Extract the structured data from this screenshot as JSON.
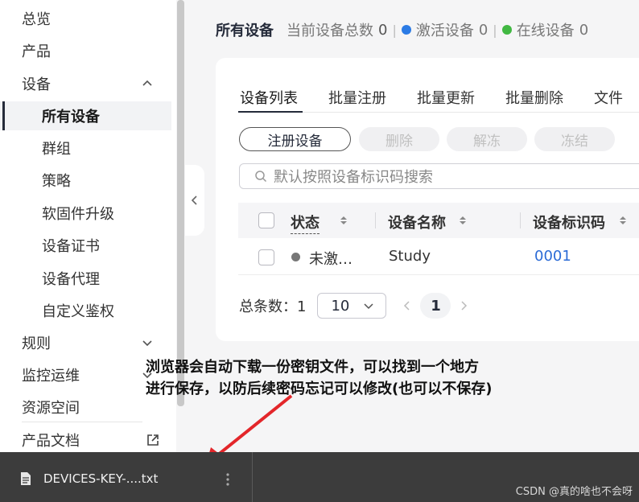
{
  "sidebar": {
    "items": [
      {
        "label": "总览"
      },
      {
        "label": "产品"
      },
      {
        "label": "设备"
      },
      {
        "label": "所有设备"
      },
      {
        "label": "群组"
      },
      {
        "label": "策略"
      },
      {
        "label": "软固件升级"
      },
      {
        "label": "设备证书"
      },
      {
        "label": "设备代理"
      },
      {
        "label": "自定义鉴权"
      },
      {
        "label": "规则"
      },
      {
        "label": "监控运维"
      },
      {
        "label": "资源空间"
      },
      {
        "label": "产品文档"
      }
    ]
  },
  "header": {
    "title": "所有设备",
    "total_label": "当前设备总数",
    "total_value": "0",
    "active_label": "激活设备",
    "active_value": "0",
    "online_label": "在线设备",
    "online_value": "0",
    "active_color": "#2b7be5",
    "online_color": "#41b842"
  },
  "tabs": [
    {
      "label": "设备列表"
    },
    {
      "label": "批量注册"
    },
    {
      "label": "批量更新"
    },
    {
      "label": "批量删除"
    },
    {
      "label": "文件"
    }
  ],
  "toolbar": {
    "register_label": "注册设备",
    "delete_label": "删除",
    "unfreeze_label": "解冻",
    "freeze_label": "冻结"
  },
  "search": {
    "placeholder": "默认按照设备标识码搜索"
  },
  "table": {
    "columns": [
      "状态",
      "设备名称",
      "设备标识码"
    ],
    "rows": [
      {
        "status": "未激…",
        "name": "Study",
        "identifier": "0001"
      }
    ]
  },
  "pagination": {
    "total_label": "总条数：1",
    "page_size": "10",
    "current_page": "1"
  },
  "annotation": {
    "line1": "浏览器会自动下载一份密钥文件，可以找到一个地方",
    "line2": "进行保存，以防后续密码忘记可以修改(也可以不保存)"
  },
  "download": {
    "filename": "DEVICES-KEY-....txt"
  },
  "watermark": "CSDN @真的啥也不会呀"
}
